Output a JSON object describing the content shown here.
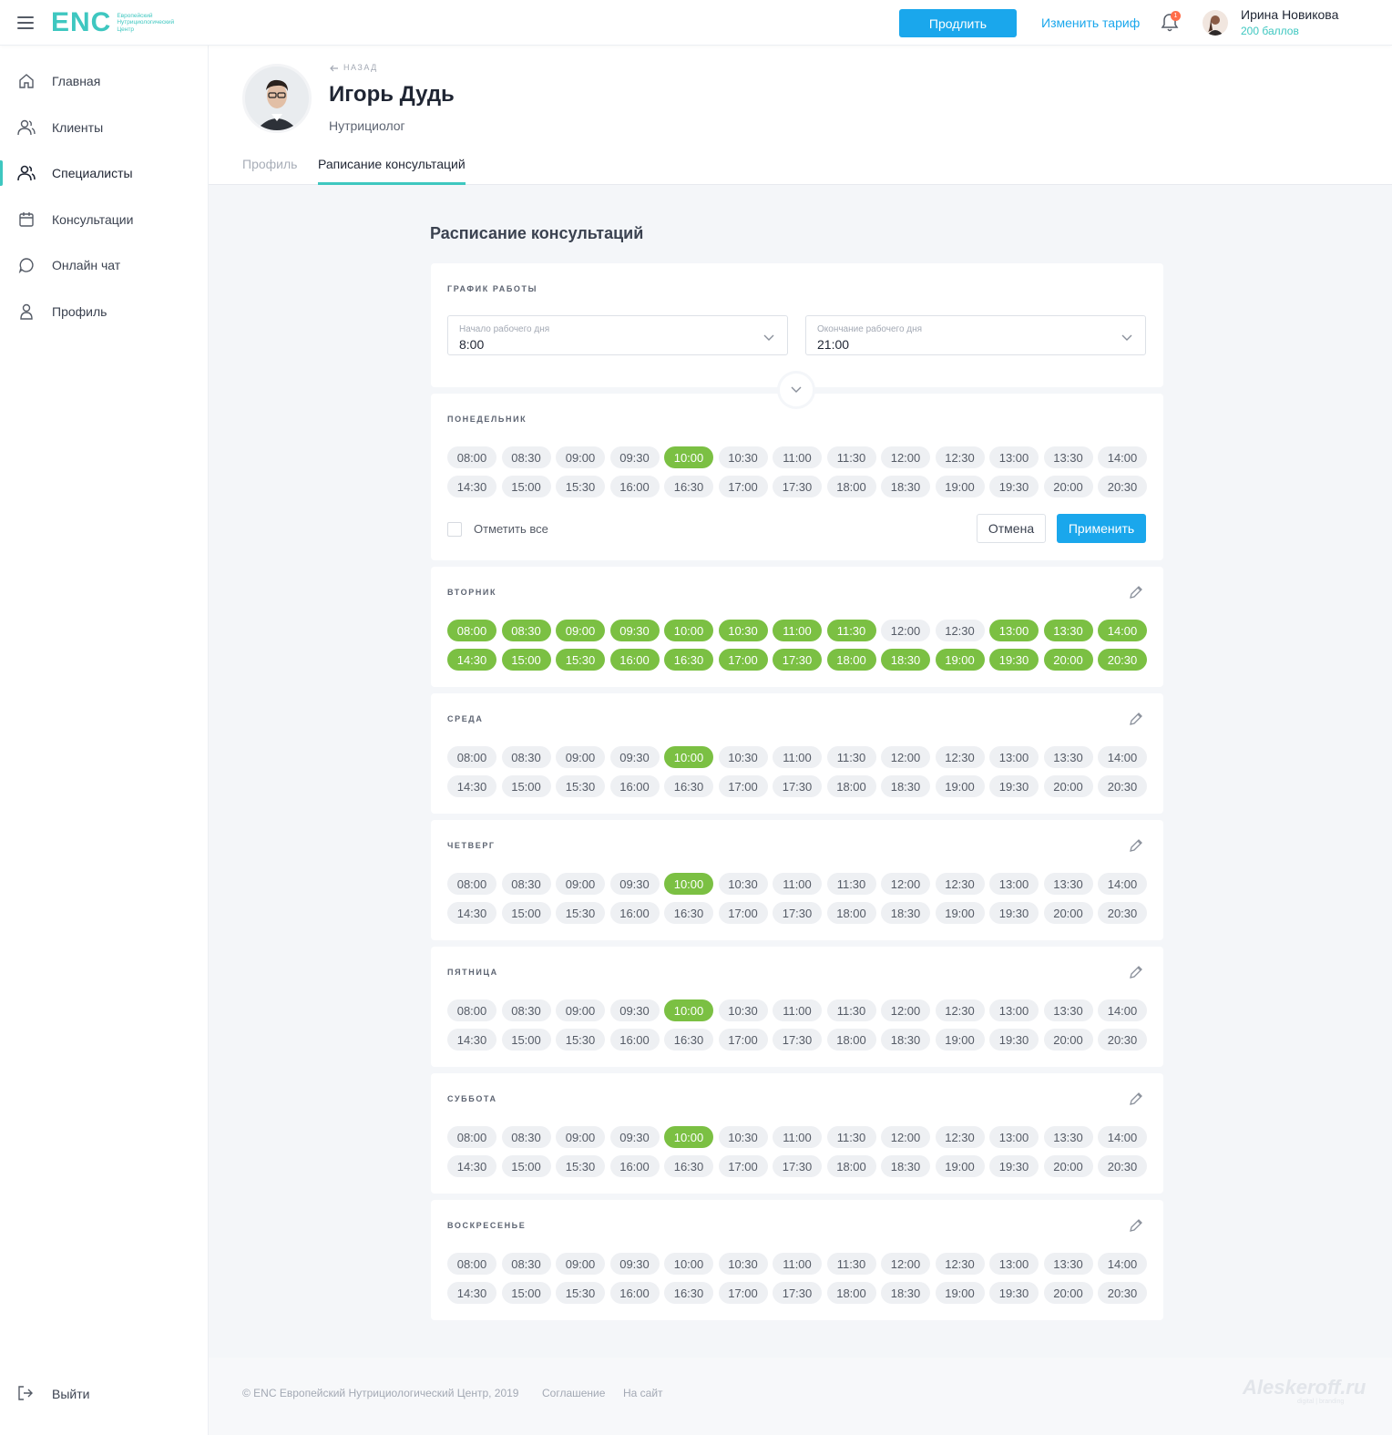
{
  "header": {
    "logo": "ENC",
    "logo_subtitle": "Европейский Нутрициологический Центр",
    "extend_button": "Продлить",
    "change_tariff": "Изменить тариф",
    "notifications_count": "1",
    "user_name": "Ирина Новикова",
    "user_points": "200 баллов"
  },
  "sidebar": {
    "items": [
      {
        "label": "Главная",
        "icon": "home-icon"
      },
      {
        "label": "Клиенты",
        "icon": "users-icon"
      },
      {
        "label": "Специалисты",
        "icon": "specialists-icon",
        "active": true
      },
      {
        "label": "Консультации",
        "icon": "calendar-icon"
      },
      {
        "label": "Онлайн чат",
        "icon": "chat-icon"
      },
      {
        "label": "Профиль",
        "icon": "user-icon"
      }
    ],
    "logout": "Выйти"
  },
  "profile": {
    "back": "НАЗАД",
    "name": "Игорь Дудь",
    "role": "Нутрициолог",
    "tabs": [
      "Профиль",
      "Раписание консультаций"
    ]
  },
  "schedule": {
    "title": "Расписание консультаций",
    "work_hours_label": "График работы",
    "start_label": "Начало рабочего дня",
    "start_value": "8:00",
    "end_label": "Окончание рабочего дня",
    "end_value": "21:00",
    "times": [
      "08:00",
      "08:30",
      "09:00",
      "09:30",
      "10:00",
      "10:30",
      "11:00",
      "11:30",
      "12:00",
      "12:30",
      "13:00",
      "13:30",
      "14:00",
      "14:30",
      "15:00",
      "15:30",
      "16:00",
      "16:30",
      "17:00",
      "17:30",
      "18:00",
      "18:30",
      "19:00",
      "19:30",
      "20:00",
      "20:30"
    ],
    "days": [
      {
        "name": "Понедельник",
        "selected": [
          "10:00"
        ],
        "editing": true
      },
      {
        "name": "Вторник",
        "selected": [
          "08:00",
          "08:30",
          "09:00",
          "09:30",
          "10:00",
          "10:30",
          "11:00",
          "11:30",
          "13:00",
          "13:30",
          "14:00",
          "14:30",
          "15:00",
          "15:30",
          "16:00",
          "16:30",
          "17:00",
          "17:30",
          "18:00",
          "18:30",
          "19:00",
          "19:30",
          "20:00",
          "20:30"
        ]
      },
      {
        "name": "Среда",
        "selected": [
          "10:00"
        ]
      },
      {
        "name": "Четверг",
        "selected": [
          "10:00"
        ]
      },
      {
        "name": "Пятница",
        "selected": [
          "10:00"
        ]
      },
      {
        "name": "Суббота",
        "selected": [
          "10:00"
        ]
      },
      {
        "name": "Воскресенье",
        "selected": []
      }
    ],
    "select_all": "Отметить все",
    "cancel": "Отмена",
    "apply": "Применить"
  },
  "footer": {
    "copyright": "© ENC Европейский Нутрициологический Центр, 2019",
    "agreement": "Соглашение",
    "site": "На сайт",
    "watermark": "Aleskeroff.ru",
    "watermark_sub": "digital | branding"
  },
  "colors": {
    "accent": "#3ec7c0",
    "primary": "#1aa7ec",
    "selected_slot": "#7bc043",
    "badge": "#ff6d4a"
  }
}
